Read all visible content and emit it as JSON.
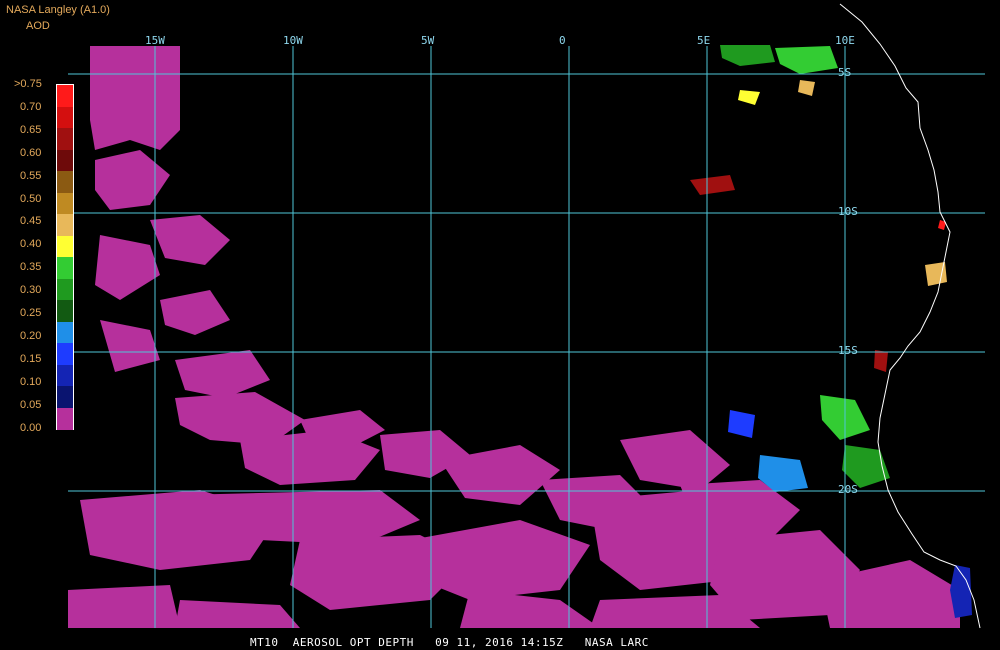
{
  "header": {
    "title": "NASA Langley (A1.0)",
    "product_label": "AOD"
  },
  "colorbar": {
    "labels": [
      ">0.75",
      "0.70",
      "0.65",
      "0.60",
      "0.55",
      "0.50",
      "0.45",
      "0.40",
      "0.35",
      "0.30",
      "0.25",
      "0.20",
      "0.15",
      "0.10",
      "0.05",
      "0.00"
    ],
    "colors": [
      "#ff1a1a",
      "#d40f0f",
      "#a01010",
      "#6e0a0a",
      "#8b5a12",
      "#bf8a22",
      "#e8b85a",
      "#ffff33",
      "#33cc33",
      "#1f9a1f",
      "#125a12",
      "#1f8fe8",
      "#1e3cff",
      "#1424b4",
      "#0a1470",
      "#b6309c"
    ]
  },
  "grid": {
    "longitude_labels": [
      "15W",
      "10W",
      "5W",
      "0",
      "5E",
      "10E"
    ],
    "latitude_labels": [
      "5S",
      "10S",
      "15S",
      "20S"
    ]
  },
  "footer": {
    "caption": "MT10  AEROSOL OPT DEPTH   09 11, 2016 14:15Z   NASA LARC"
  },
  "colors": {
    "background": "#000000",
    "grid_line": "#4fc6d8",
    "coastline": "#ffffff",
    "aod_low": "#b6309c"
  }
}
